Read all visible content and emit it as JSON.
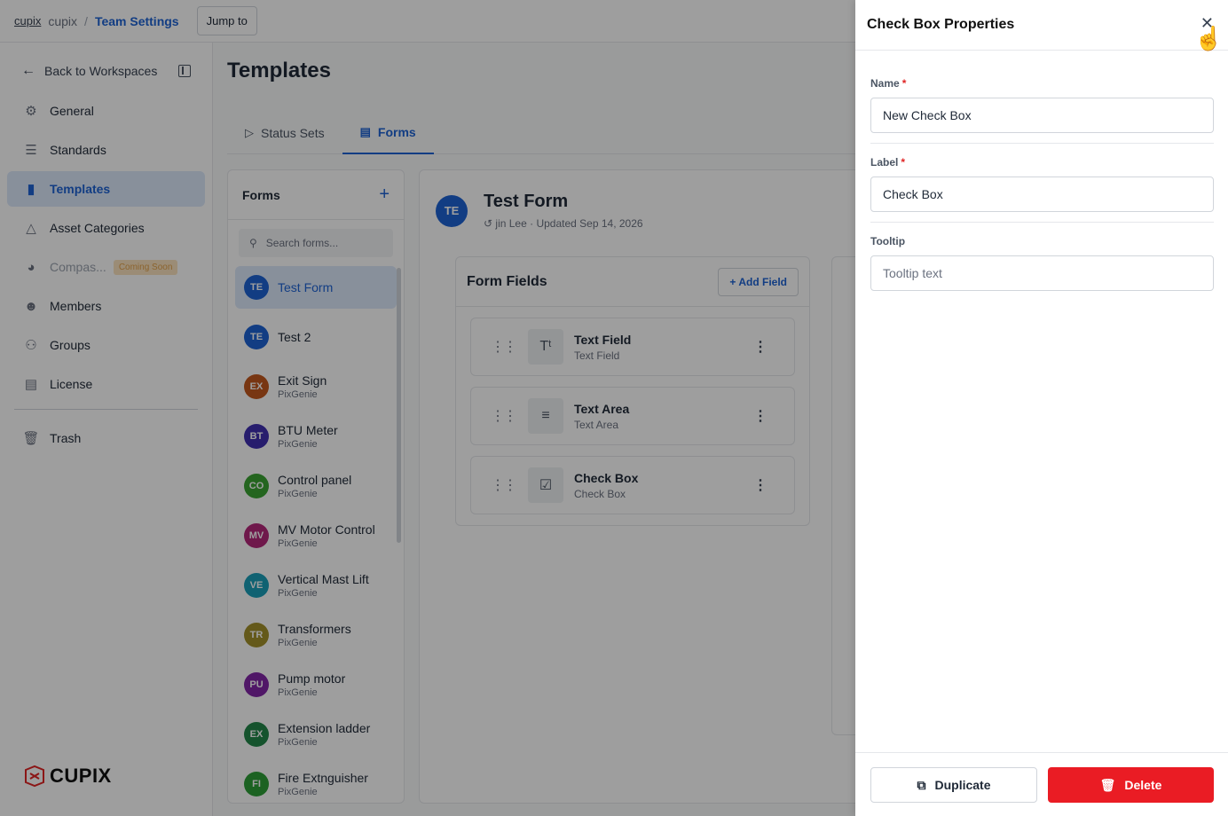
{
  "topbar": {
    "logo": "cupix",
    "workspace": "cupix",
    "separator": "/",
    "current": "Team Settings",
    "jump_label": "Jump to"
  },
  "sidebar": {
    "back_label": "Back to Workspaces",
    "items": [
      {
        "label": "General",
        "icon": "gear-icon"
      },
      {
        "label": "Standards",
        "icon": "sliders-icon"
      },
      {
        "label": "Templates",
        "icon": "document-icon",
        "active": true
      },
      {
        "label": "Asset Categories",
        "icon": "shapes-icon"
      },
      {
        "label": "Compas...",
        "icon": "compass-icon",
        "badge": "Coming Soon"
      },
      {
        "label": "Members",
        "icon": "person-icon"
      },
      {
        "label": "Groups",
        "icon": "group-icon"
      },
      {
        "label": "License",
        "icon": "license-icon"
      },
      {
        "label": "Trash",
        "icon": "trash-icon"
      }
    ],
    "brand": "CUPIX"
  },
  "main": {
    "title": "Templates",
    "tabs": [
      {
        "label": "Status Sets",
        "icon": "tag-icon"
      },
      {
        "label": "Forms",
        "icon": "document-icon",
        "active": true
      }
    ]
  },
  "forms_panel": {
    "title": "Forms",
    "search_placeholder": "Search forms...",
    "items": [
      {
        "initials": "TE",
        "name": "Test Form",
        "sub": "",
        "color": "#1e63d4"
      },
      {
        "initials": "TE",
        "name": "Test 2",
        "sub": "",
        "color": "#1e63d4"
      },
      {
        "initials": "EX",
        "name": "Exit Sign",
        "sub": "PixGenie",
        "color": "#c2581e"
      },
      {
        "initials": "BT",
        "name": "BTU Meter",
        "sub": "PixGenie",
        "color": "#3f2fb0"
      },
      {
        "initials": "CO",
        "name": "Control panel",
        "sub": "PixGenie",
        "color": "#3aa332"
      },
      {
        "initials": "MV",
        "name": "MV Motor Control",
        "sub": "PixGenie",
        "color": "#b3277a"
      },
      {
        "initials": "VE",
        "name": "Vertical Mast Lift",
        "sub": "PixGenie",
        "color": "#1a9fb8"
      },
      {
        "initials": "TR",
        "name": "Transformers",
        "sub": "PixGenie",
        "color": "#a2902a"
      },
      {
        "initials": "PU",
        "name": "Pump motor",
        "sub": "PixGenie",
        "color": "#8226a6"
      },
      {
        "initials": "EX",
        "name": "Extension ladder",
        "sub": "PixGenie",
        "color": "#23874a"
      },
      {
        "initials": "FI",
        "name": "Fire Extnguisher",
        "sub": "PixGenie",
        "color": "#2e9e38"
      }
    ]
  },
  "detail": {
    "initials": "TE",
    "title": "Test Form",
    "author": "jin Lee",
    "dot": "·",
    "updated": "Updated Sep 14, 2026",
    "form_fields_title": "Form Fields",
    "add_field_label": "Add Field",
    "fields": [
      {
        "name": "Text Field",
        "type": "Text Field",
        "icon": "text-type-icon"
      },
      {
        "name": "Text Area",
        "type": "Text Area",
        "icon": "lines-icon"
      },
      {
        "name": "Check Box",
        "type": "Check Box",
        "icon": "checkbox-icon"
      }
    ]
  },
  "properties": {
    "title": "Check Box Properties",
    "name_label": "Name",
    "name_value": "New Check Box",
    "label_label": "Label",
    "label_value": "Check Box",
    "tooltip_label": "Tooltip",
    "tooltip_placeholder": "Tooltip text",
    "required_mark": "*",
    "duplicate_label": "Duplicate",
    "delete_label": "Delete"
  },
  "colors": {
    "accent": "#1e63d4",
    "danger": "#ea1c24",
    "active_bg": "#dce8fb"
  }
}
